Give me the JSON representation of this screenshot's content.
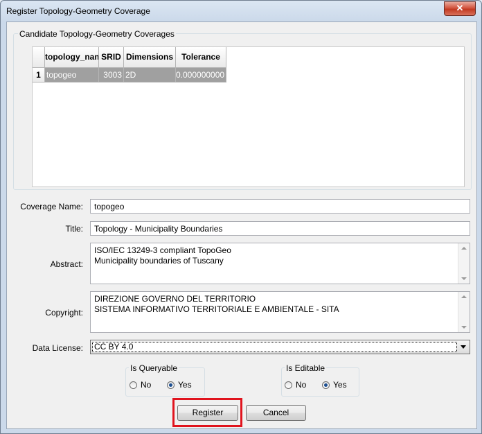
{
  "window": {
    "title": "Register Topology-Geometry Coverage",
    "close_symbol": "✕"
  },
  "candidates": {
    "group_title": "Candidate Topology-Geometry Coverages",
    "columns": [
      "topology_name",
      "SRID",
      "Dimensions",
      "Tolerance"
    ],
    "rows": [
      {
        "index": "1",
        "topology_name": "topogeo",
        "srid": "3003",
        "dimensions": "2D",
        "tolerance": "0.000000000"
      }
    ]
  },
  "form": {
    "coverage_name": {
      "label": "Coverage Name:",
      "value": "topogeo"
    },
    "title": {
      "label": "Title:",
      "value": "Topology - Municipality Boundaries"
    },
    "abstract": {
      "label": "Abstract:",
      "value": "ISO/IEC 13249-3 compliant TopoGeo\nMunicipality boundaries of Tuscany"
    },
    "copyright": {
      "label": "Copyright:",
      "value": "DIREZIONE GOVERNO DEL TERRITORIO\nSISTEMA INFORMATIVO TERRITORIALE E AMBIENTALE - SITA"
    },
    "data_license": {
      "label": "Data License:",
      "value": "CC BY 4.0"
    }
  },
  "queryable": {
    "title": "Is Queryable",
    "no_label": "No",
    "yes_label": "Yes",
    "selected": "Yes"
  },
  "editable": {
    "title": "Is Editable",
    "no_label": "No",
    "yes_label": "Yes",
    "selected": "Yes"
  },
  "buttons": {
    "register": "Register",
    "cancel": "Cancel"
  },
  "colors": {
    "highlight": "#e0141e",
    "selected_row": "#a0a0a0"
  }
}
